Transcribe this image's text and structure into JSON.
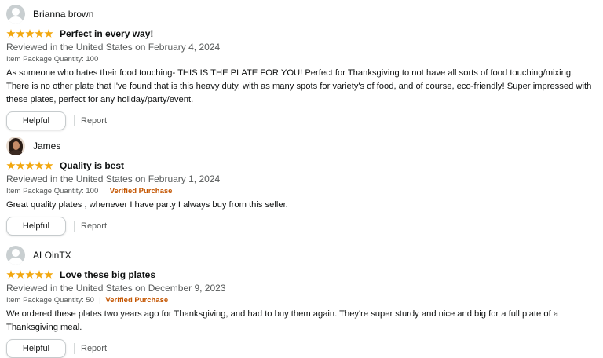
{
  "reviews": [
    {
      "author": "Brianna brown",
      "avatar": "default-avatar",
      "rating": 5,
      "title": "Perfect in every way!",
      "reviewed": "Reviewed in the United States on February 4, 2024",
      "quantity": "Item Package Quantity: 100",
      "verified": "",
      "body": "As someone who hates their food touching- THIS IS THE PLATE FOR YOU! Perfect for Thanksgiving to not have all sorts of food touching/mixing. There is no other plate that I've found that is this heavy duty, with as many spots for variety's of food, and of course, eco-friendly! Super impressed with these plates, perfect for any holiday/party/event.",
      "helpful": "Helpful",
      "report": "Report"
    },
    {
      "author": "James",
      "avatar": "photo-avatar",
      "rating": 5,
      "title": "Quality is best",
      "reviewed": "Reviewed in the United States on February 1, 2024",
      "quantity": "Item Package Quantity: 100",
      "verified": "Verified Purchase",
      "body": "Great quality plates , whenever I have party I always buy from this seller.",
      "helpful": "Helpful",
      "report": "Report"
    },
    {
      "author": "ALOinTX",
      "avatar": "default-avatar",
      "rating": 5,
      "title": "Love these big plates",
      "reviewed": "Reviewed in the United States on December 9, 2023",
      "quantity": "Item Package Quantity: 50",
      "verified": "Verified Purchase",
      "body": "We ordered these plates two years ago for Thanksgiving, and had to buy them again. They're super sturdy and nice and big for a full plate of a Thanksgiving meal.",
      "helpful": "Helpful",
      "report": "Report"
    }
  ],
  "colors": {
    "star": "#f2a70e",
    "verified": "#c45500",
    "meta": "#565959",
    "text": "#0f1111"
  }
}
